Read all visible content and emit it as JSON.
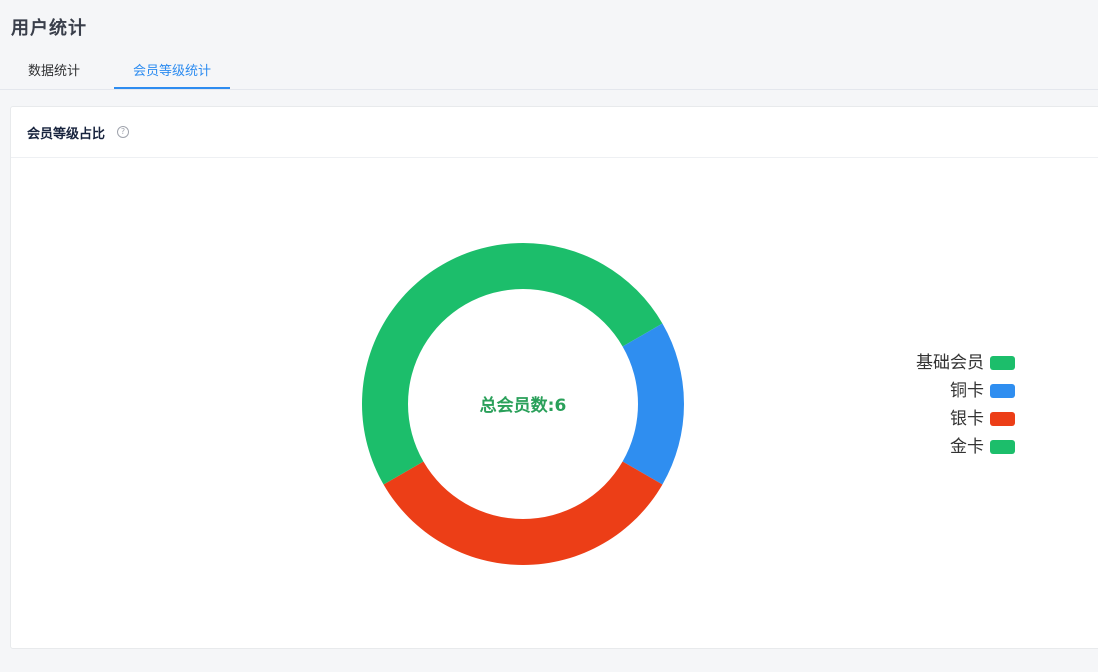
{
  "header": {
    "title": "用户统计"
  },
  "tabs": [
    {
      "label": "数据统计",
      "active": false
    },
    {
      "label": "会员等级统计",
      "active": true
    }
  ],
  "card": {
    "title": "会员等级占比",
    "help_icon": "question-circle-icon"
  },
  "colors": {
    "accent": "#2d8cf0",
    "center_text": "#2aa05a"
  },
  "chart_data": {
    "type": "pie",
    "donut": true,
    "center_label": "总会员数:6",
    "categories": [
      "基础会员",
      "铜卡",
      "银卡",
      "金卡"
    ],
    "values": [
      2,
      1,
      2,
      1
    ],
    "colors": [
      "#1cbe6b",
      "#2f8ef0",
      "#ec3e17",
      "#1cbe6b"
    ],
    "legend": "right",
    "slice_order": [
      "金卡",
      "铜卡",
      "银卡",
      "基础会员"
    ]
  }
}
